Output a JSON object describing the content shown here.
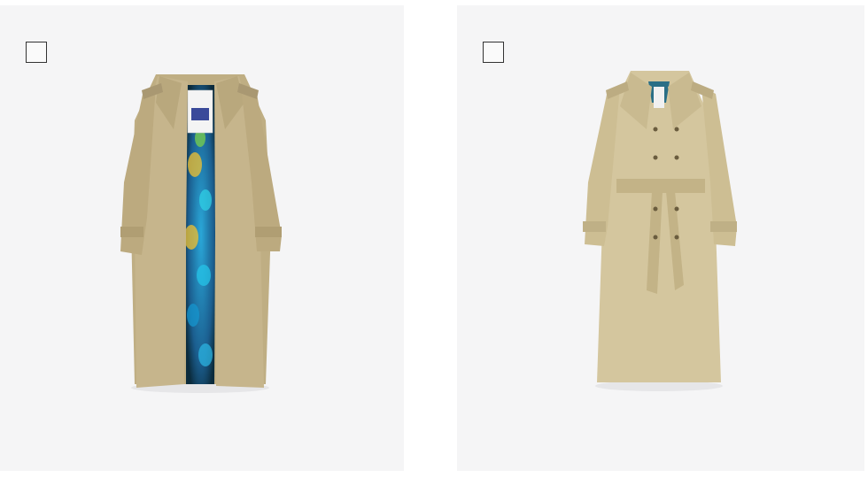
{
  "products": [
    {
      "title": "",
      "image": "open-trench-coat-with-printed-lining",
      "checkbox_checked": false,
      "colors": {
        "coat": "#c6b58c",
        "lining": "#1b6fa0",
        "background": "#f5f5f6"
      }
    },
    {
      "title": "",
      "image": "belted-trench-coat",
      "checkbox_checked": false,
      "colors": {
        "coat": "#d4c69e",
        "background": "#f5f5f6"
      }
    }
  ]
}
